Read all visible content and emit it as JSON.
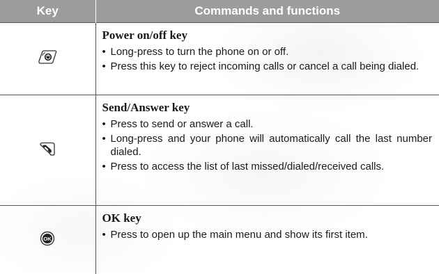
{
  "header": {
    "key_col": "Key",
    "cmd_col": "Commands and functions"
  },
  "rows": [
    {
      "icon": "power-end-key-icon",
      "title": "Power on/off key",
      "bullets": [
        "Long-press to turn the phone on or off.",
        "Press this key to reject incoming calls or cancel a call being dialed."
      ]
    },
    {
      "icon": "send-answer-key-icon",
      "title": "Send/Answer key",
      "bullets": [
        "Press to send or answer a call.",
        "Long-press and your phone will automatically call the last number dialed.",
        "Press to access the list of last missed/dialed/received calls."
      ]
    },
    {
      "icon": "ok-key-icon",
      "title": "OK key",
      "bullets": [
        "Press to open up the main menu and show its first item."
      ]
    }
  ]
}
